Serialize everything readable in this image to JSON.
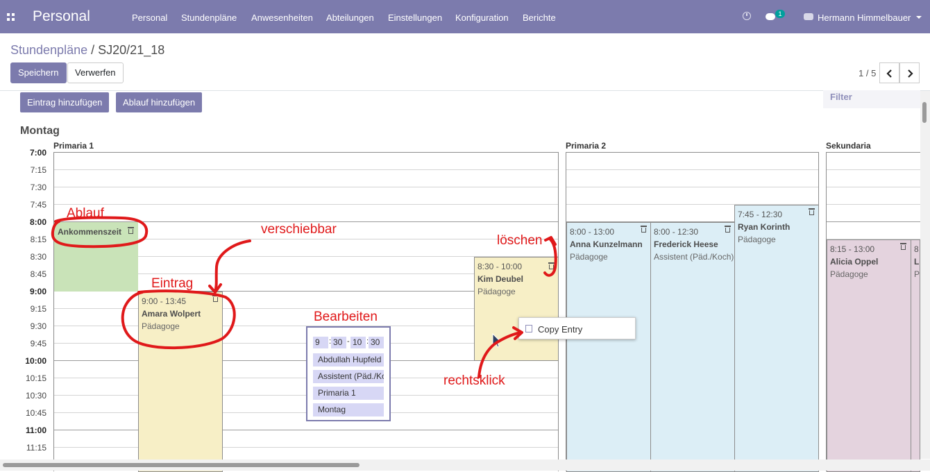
{
  "navbar": {
    "brand": "Personal",
    "menu": [
      "Personal",
      "Stundenpläne",
      "Anwesenheiten",
      "Abteilungen",
      "Einstellungen",
      "Konfiguration",
      "Berichte"
    ],
    "chat_count": "1",
    "user_name": "Hermann Himmelbauer"
  },
  "breadcrumb": {
    "parent": "Stundenpläne",
    "separator": "/",
    "current": "SJ20/21_18"
  },
  "buttons": {
    "save": "Speichern",
    "discard": "Verwerfen"
  },
  "pager": {
    "value": "1 / 5"
  },
  "toolbar": {
    "add_entry": "Eintrag hinzufügen",
    "add_sequence": "Ablauf hinzufügen",
    "filter": "Filter"
  },
  "schedule": {
    "day": "Montag",
    "columns": [
      "Primaria 1",
      "Primaria 2",
      "Sekundaria"
    ],
    "times": [
      "7:00",
      "7:15",
      "7:30",
      "7:45",
      "8:00",
      "8:15",
      "8:30",
      "8:45",
      "9:00",
      "9:15",
      "9:30",
      "9:45",
      "10:00",
      "10:15",
      "10:30",
      "10:45",
      "11:00",
      "11:15"
    ],
    "sequence": {
      "name": "Ankommenszeit"
    },
    "entries": [
      {
        "time": "9:00  -  13:45",
        "name": "Amara Wolpert",
        "role": "Pädagoge"
      },
      {
        "time": "8:30  -  10:00",
        "name": "Kim Deubel",
        "role": "Pädagoge"
      },
      {
        "time": "8:00  -  13:00",
        "name": "Anna Kunzelmann",
        "role": "Pädagoge"
      },
      {
        "time": "8:00  -  12:30",
        "name": "Frederick Heese",
        "role": "Assistent (Päd./Koch)"
      },
      {
        "time": "7:45  -  12:30",
        "name": "Ryan Korinth",
        "role": "Pädagoge"
      },
      {
        "time": "8:15  -  13:00",
        "name": "Alicia Oppel",
        "role": "Pädagoge"
      },
      {
        "time": "8",
        "name": "L",
        "role": "P"
      }
    ]
  },
  "edit_popup": {
    "start_hour": "9",
    "start_min": "30",
    "end_hour": "10",
    "end_min": "30",
    "separator": "-",
    "colon": ":",
    "employee": "Abdullah Hupfeld",
    "role": "Assistent (Päd./Koch)",
    "room": "Primaria 1",
    "day": "Montag"
  },
  "context_menu": {
    "copy": "Copy Entry"
  },
  "annotations": {
    "ablauf": "Ablauf",
    "verschiebbar": "verschiebbar",
    "eintrag": "Eintrag",
    "bearbeiten": "Bearbeiten",
    "loeschen": "löschen",
    "rechtsklick": "rechtsklick"
  },
  "colors": {
    "navbar": "#7c7bad",
    "sequence": "#c9e3b8",
    "entry_primaria1": "#f7efc6",
    "entry_primaria2": "#dceef6",
    "entry_sekundaria": "#e4d3de",
    "annotation": "#e0191a"
  }
}
